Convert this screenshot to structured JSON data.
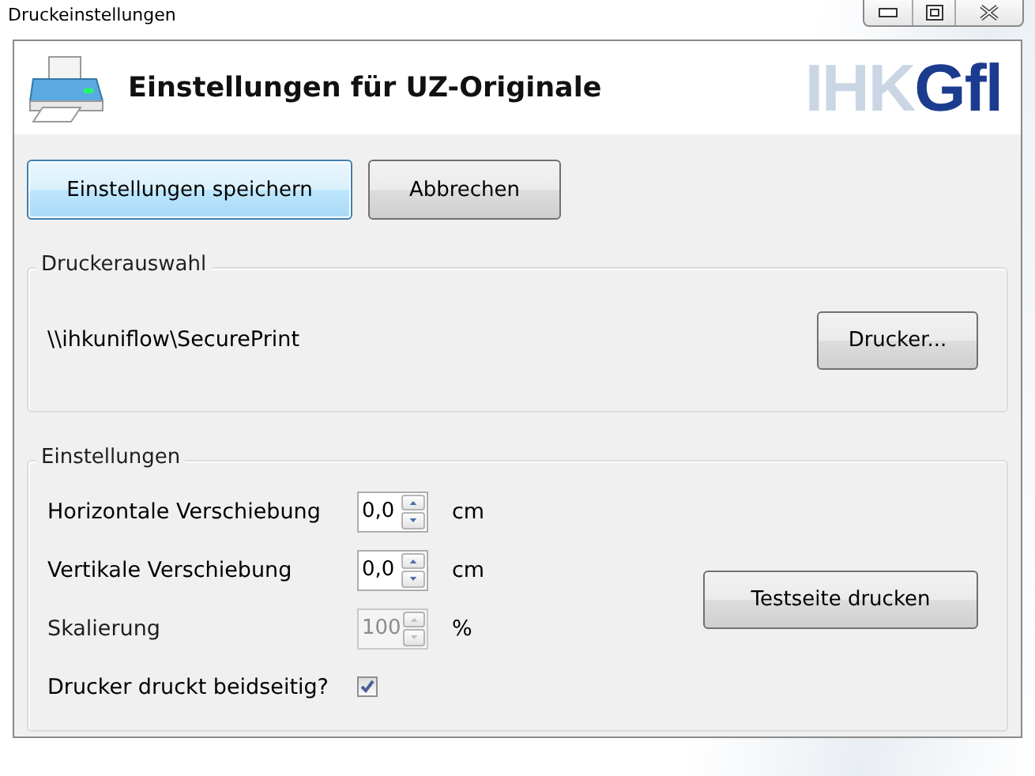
{
  "window": {
    "title": "Druckeinstellungen"
  },
  "header": {
    "title": "Einstellungen für UZ-Originale",
    "logo": {
      "part_1": "IHK",
      "part_2": "Gfl"
    }
  },
  "buttons": [
    {
      "label": "Einstellungen speichern",
      "focused": true
    },
    {
      "label": "Abbrechen",
      "focused": false
    }
  ],
  "printer_group": {
    "title": "Druckerauswahl",
    "printer": "\\\\ihkuniflow\\SecurePrint",
    "button": "Drucker..."
  },
  "settings_group": {
    "title": "Einstellungen",
    "rows": [
      {
        "kind": "spinner",
        "label": "Horizontale Verschiebung",
        "value": "0,0",
        "unit": "cm",
        "disabled": false
      },
      {
        "kind": "spinner",
        "label": "Vertikale Verschiebung",
        "value": "0,0",
        "unit": "cm",
        "disabled": false
      },
      {
        "kind": "spinner",
        "label": "Skalierung",
        "value": "100",
        "unit": "%",
        "disabled": true
      },
      {
        "kind": "checkbox",
        "label": "Drucker druckt beidseitig?",
        "checked": true
      }
    ],
    "test_button": "Testseite drucken"
  }
}
